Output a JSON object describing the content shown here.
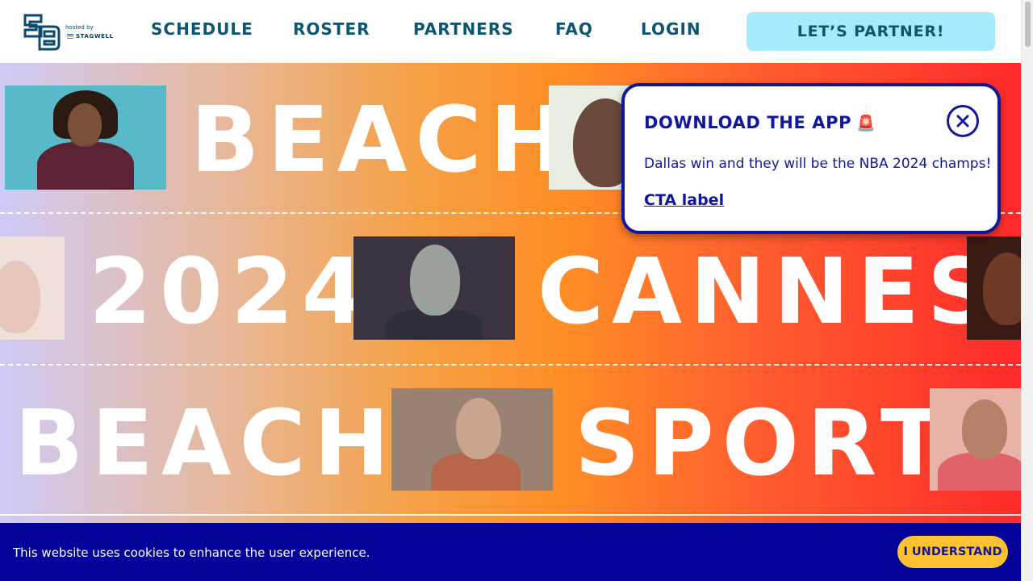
{
  "header": {
    "logo_hosted": "hosted by",
    "logo_brand": "STAGWELL",
    "nav": [
      {
        "label": "SCHEDULE"
      },
      {
        "label": "ROSTER"
      },
      {
        "label": "PARTNERS"
      },
      {
        "label": "FAQ"
      },
      {
        "label": "LOGIN"
      }
    ],
    "cta_label": "LET’S PARTNER!"
  },
  "hero": {
    "row1": [
      "BEACH"
    ],
    "row2": [
      "2024",
      "CANNES"
    ],
    "row3": [
      "BEACH",
      "SPORT"
    ]
  },
  "popup": {
    "title": "DOWNLOAD THE APP",
    "title_icon": "siren-icon",
    "message": "Dallas win and they will be the NBA 2024 champs!",
    "link_label": "CTA label",
    "close_icon": "close-icon"
  },
  "cookie_banner": {
    "text": "This website uses cookies to enhance the user experience.",
    "button_label": "I UNDERSTAND"
  },
  "colors": {
    "brand_navy": "#11179a",
    "nav_teal": "#0c5674",
    "cta_bg": "#a6ebfb",
    "cookie_bg": "#03039a",
    "cookie_button": "#fec12f"
  }
}
